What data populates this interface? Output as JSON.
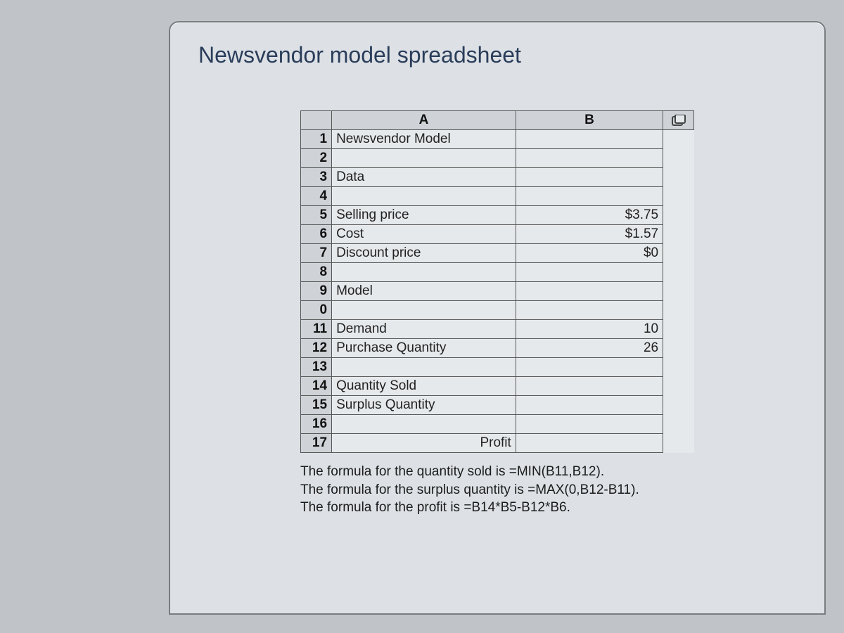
{
  "title": "Newsvendor model spreadsheet",
  "columns": {
    "A": "A",
    "B": "B"
  },
  "rows": [
    {
      "n": "1",
      "a": "Newsvendor Model",
      "b": ""
    },
    {
      "n": "2",
      "a": "",
      "b": ""
    },
    {
      "n": "3",
      "a": "Data",
      "b": ""
    },
    {
      "n": "4",
      "a": "",
      "b": ""
    },
    {
      "n": "5",
      "a": "Selling price",
      "b": "$3.75"
    },
    {
      "n": "6",
      "a": "Cost",
      "b": "$1.57"
    },
    {
      "n": "7",
      "a": "Discount price",
      "b": "$0"
    },
    {
      "n": "8",
      "a": "",
      "b": ""
    },
    {
      "n": "9",
      "a": "Model",
      "b": ""
    },
    {
      "n": "0",
      "a": "",
      "b": ""
    },
    {
      "n": "11",
      "a": "Demand",
      "b": "10"
    },
    {
      "n": "12",
      "a": "Purchase Quantity",
      "b": "26"
    },
    {
      "n": "13",
      "a": "",
      "b": ""
    },
    {
      "n": "14",
      "a": "Quantity Sold",
      "b": ""
    },
    {
      "n": "15",
      "a": "Surplus Quantity",
      "b": ""
    },
    {
      "n": "16",
      "a": "",
      "b": ""
    },
    {
      "n": "17",
      "a": "Profit",
      "b": "",
      "aRight": true
    }
  ],
  "formulas": [
    "The formula for the quantity sold is =MIN(B11,B12).",
    "The formula for the surplus quantity is =MAX(0,B12-B11).",
    "The formula for the profit is =B14*B5-B12*B6."
  ]
}
